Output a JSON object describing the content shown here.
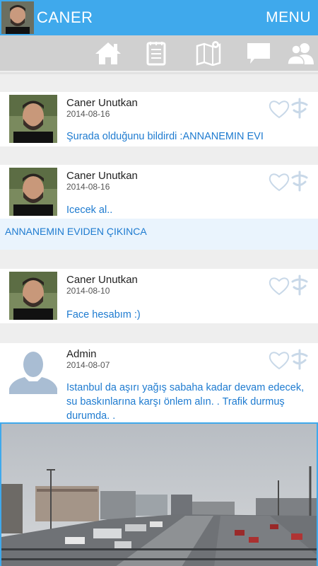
{
  "header": {
    "title": "CANER",
    "menu_label": "MENU"
  },
  "nav": {
    "icons": [
      "home-icon",
      "notes-icon",
      "map-icon",
      "chat-icon",
      "people-icon"
    ]
  },
  "colors": {
    "accent": "#3fa9ec",
    "message": "#1e7bd0",
    "navbar": "#d0d0d0"
  },
  "posts": [
    {
      "author": "Caner Unutkan",
      "date": "2014-08-16",
      "message": "Şurada olduğunu bildirdi :ANNANEMIN EVI"
    },
    {
      "author": "Caner Unutkan",
      "date": "2014-08-16",
      "message": "Icecek al..",
      "caption": "ANNANEMIN EVIDEN ÇIKINCA"
    },
    {
      "author": "Caner Unutkan",
      "date": "2014-08-10",
      "message": "Face hesabım :)"
    },
    {
      "author": "Admin",
      "date": "2014-08-07",
      "message": "Istanbul da aşırı yağış sabaha kadar devam edecek, su baskınlarına karşı önlem alın. . Trafik durmuş durumda. ."
    }
  ]
}
